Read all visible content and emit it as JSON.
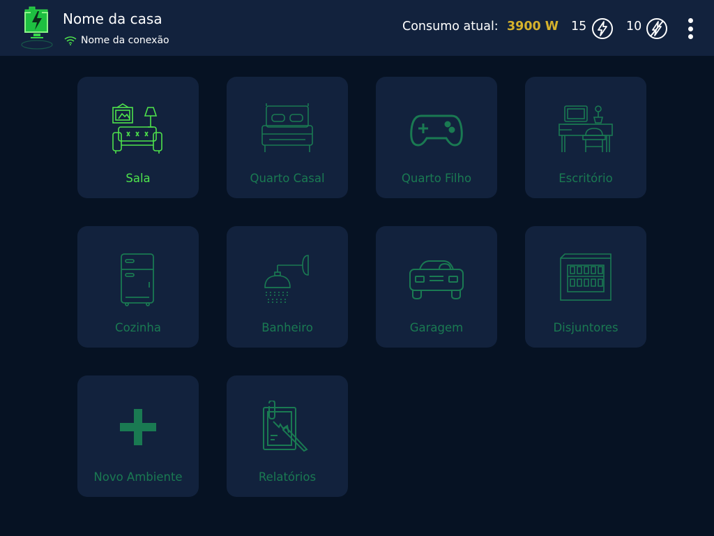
{
  "header": {
    "home_name": "Nome da casa",
    "connection_name": "Nome da conexão",
    "consumption_label": "Consumo atual:",
    "consumption_value": "3900 W",
    "powered_count": "15",
    "unpowered_count": "10"
  },
  "rooms": [
    {
      "label": "Sala",
      "icon": "sofa-icon",
      "active": true
    },
    {
      "label": "Quarto Casal",
      "icon": "double-bed-icon"
    },
    {
      "label": "Quarto Filho",
      "icon": "gamepad-icon"
    },
    {
      "label": "Escritório",
      "icon": "desk-icon"
    },
    {
      "label": "Cozinha",
      "icon": "refrigerator-icon"
    },
    {
      "label": "Banheiro",
      "icon": "shower-icon"
    },
    {
      "label": "Garagem",
      "icon": "car-icon"
    },
    {
      "label": "Disjuntores",
      "icon": "circuit-breaker-icon"
    },
    {
      "label": "Novo Ambiente",
      "icon": "plus-icon"
    },
    {
      "label": "Relatórios",
      "icon": "report-icon"
    }
  ],
  "colors": {
    "background": "#061223",
    "panel": "#12223d",
    "accent_green": "#4ee34c",
    "icon_green": "#1a7a52",
    "consumption_yellow": "#d6b22c"
  }
}
